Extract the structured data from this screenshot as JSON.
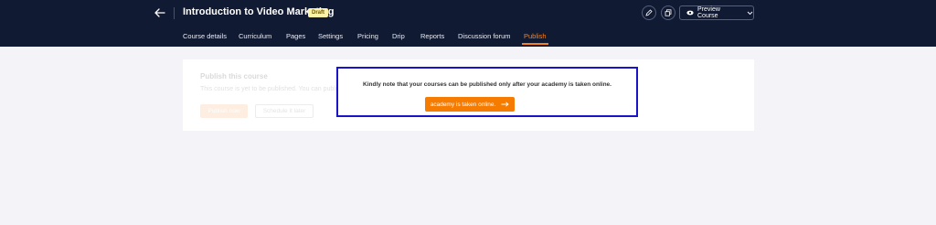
{
  "header": {
    "title": "Introduction to Video Marketing",
    "status_badge": "Draft",
    "preview_label": "Preview Course"
  },
  "tabs": [
    {
      "label": "Course details"
    },
    {
      "label": "Curriculum"
    },
    {
      "label": "Pages"
    },
    {
      "label": "Settings"
    },
    {
      "label": "Pricing"
    },
    {
      "label": "Drip"
    },
    {
      "label": "Reports"
    },
    {
      "label": "Discussion forum"
    },
    {
      "label": "Publish",
      "active": true
    }
  ],
  "publish_card": {
    "title": "Publish this course",
    "description": "This course is yet to be published. You can publish it now or schedule one to publish it later.",
    "publish_now_label": "Publish now",
    "schedule_label": "Schedule it later"
  },
  "notice": {
    "message": "Kindly note that your courses can be published only after your academy is taken online.",
    "button_label": "academy is taken online."
  },
  "colors": {
    "header_bg": "#111a33",
    "accent": "#f58220",
    "highlight_border": "#1a14c8"
  }
}
